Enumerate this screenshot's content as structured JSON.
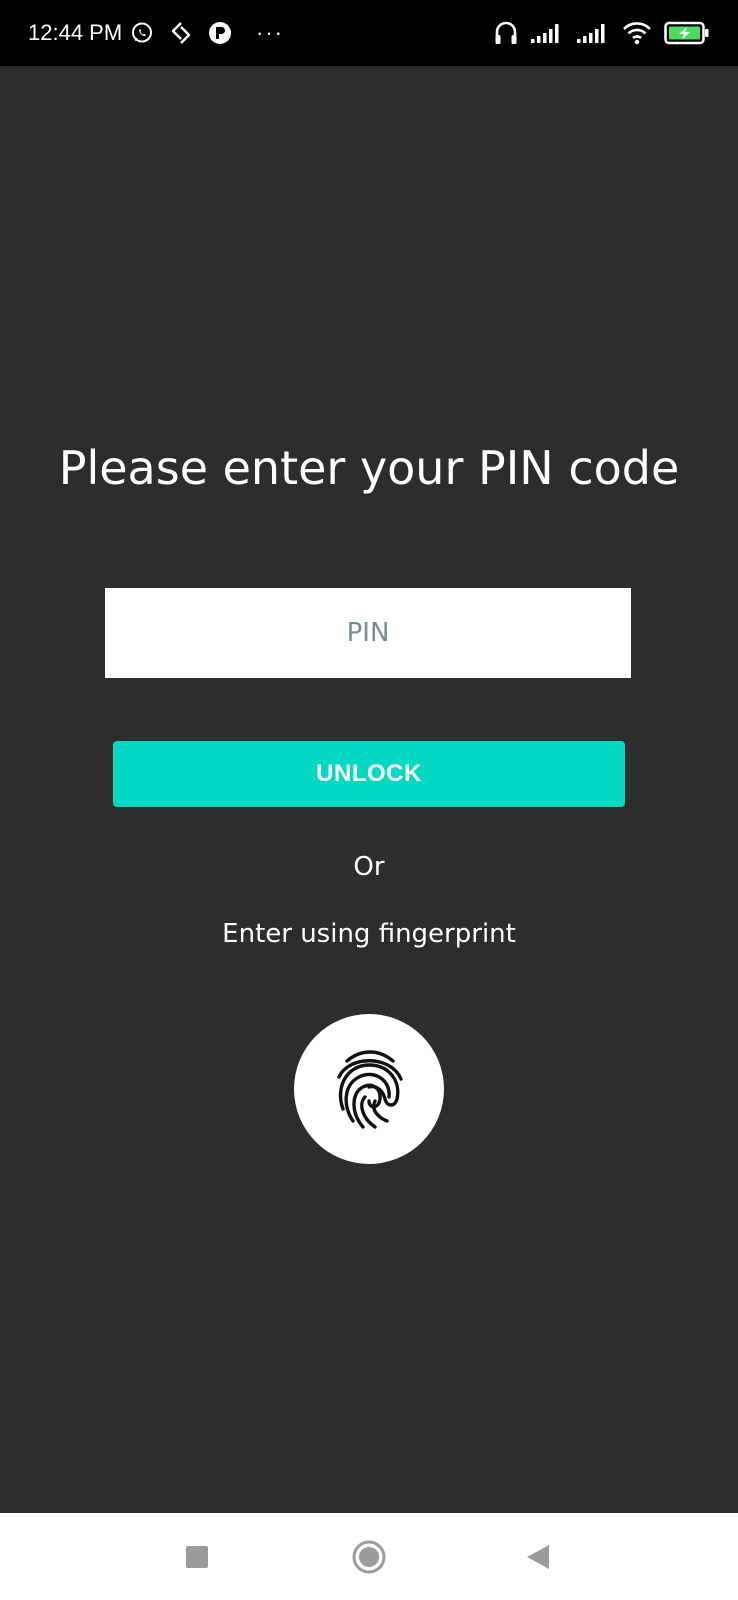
{
  "status_bar": {
    "time": "12:44 PM",
    "left_icons": [
      "whatsapp-icon",
      "sync-icon",
      "app-notification-icon",
      "more-notifications-icon"
    ],
    "right_icons": [
      "headphones-icon",
      "signal-icon",
      "signal-icon",
      "wifi-icon",
      "battery-charging-icon"
    ],
    "battery_color": "#4cd964"
  },
  "lock_screen": {
    "title": "Please enter your PIN code",
    "pin_placeholder": "PIN",
    "pin_value": "",
    "unlock_label": "UNLOCK",
    "or_label": "Or",
    "fingerprint_label": "Enter using fingerprint",
    "fingerprint_icon": "fingerprint-icon",
    "accent_color": "#03d8c3"
  },
  "nav_bar": {
    "buttons": [
      "recents-icon",
      "home-icon",
      "back-icon"
    ]
  }
}
